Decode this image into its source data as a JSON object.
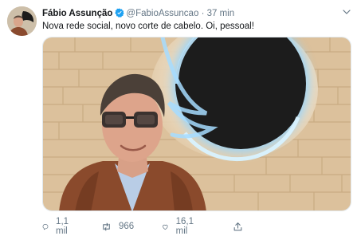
{
  "tweet": {
    "author": {
      "name": "Fábio Assunção",
      "handle": "@FabioAssuncao",
      "verified": true,
      "avatar_icon": "user-avatar"
    },
    "separator": "·",
    "time": "37 min",
    "text": "Nova rede social, novo corte de cabelo. Oi, pessoal!",
    "media": {
      "description_icon": "photo-man-glasses-twitter-logo"
    },
    "actions": {
      "reply_count": "1,1 mil",
      "retweet_count": "966",
      "like_count": "16,1 mil"
    }
  },
  "colors": {
    "text_primary": "#14171a",
    "text_secondary": "#657786",
    "verified_blue": "#1da1f2",
    "glow_blue": "#8fd3ff"
  }
}
